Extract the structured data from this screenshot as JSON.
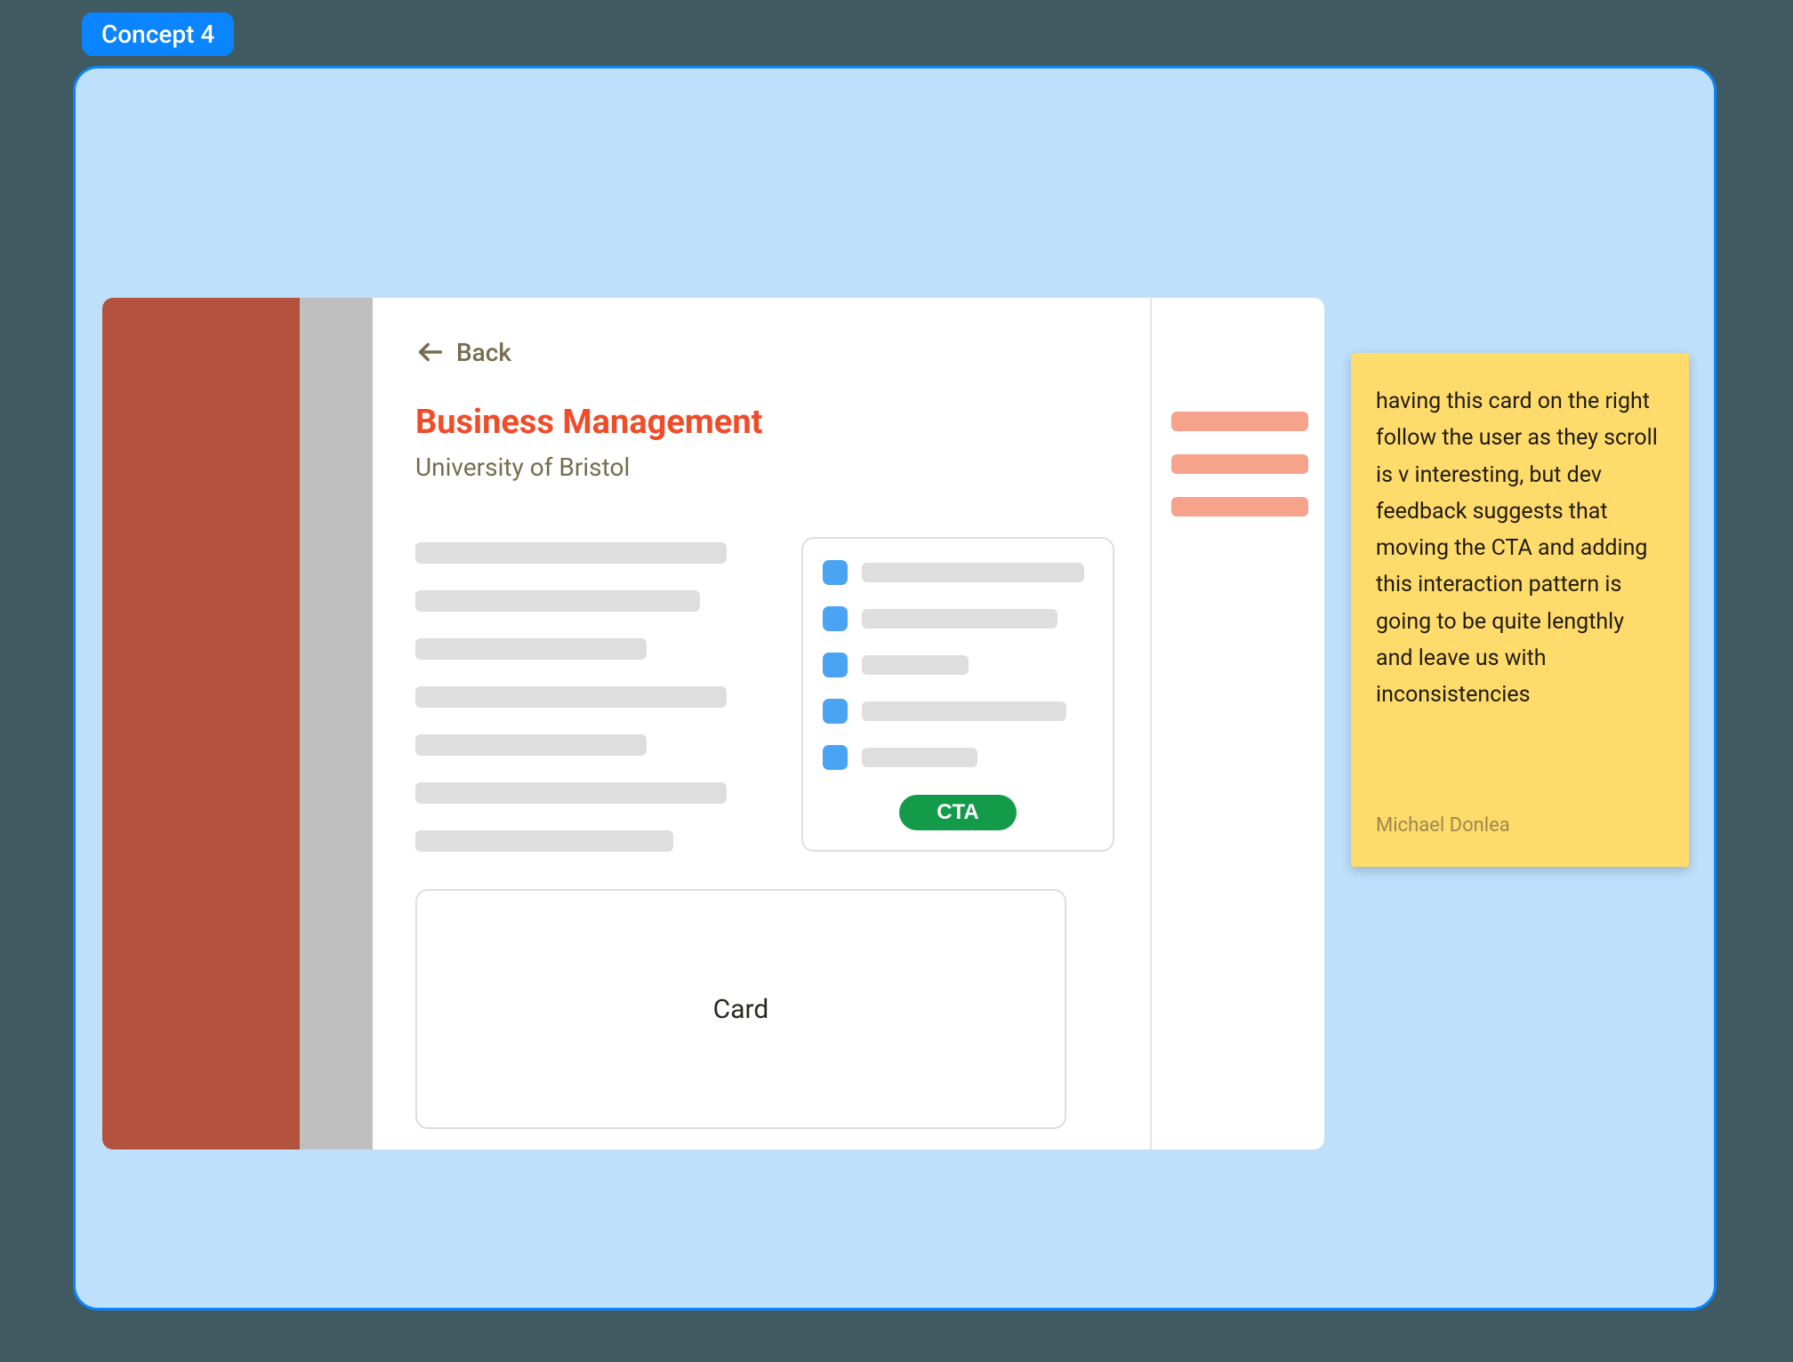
{
  "concept_tag": "Concept 4",
  "mockup": {
    "back_label": "Back",
    "title": "Business Management",
    "subtitle": "University of Bristol",
    "cta_label": "CTA",
    "card_label": "Card"
  },
  "sticky_note": {
    "text": "having this card on the right follow the user as they scroll is v interesting, but dev feedback suggests that moving the CTA and adding this interaction pattern is going to be quite lengthly and leave us with inconsistencies",
    "author": "Michael Donlea"
  },
  "colors": {
    "accent_blue": "#0a84ff",
    "panel_bg": "#bee0fa",
    "page_bg": "#3f5a61",
    "title_red": "#f04c2a",
    "muted_text": "#766d4e",
    "cta_green": "#149b49",
    "note_bg": "#ffdb6b",
    "column_red": "#b3533e",
    "column_gray": "#bfbfbf",
    "placeholder_gray": "#dedede",
    "bullet_blue": "#4aa3f3",
    "rail_coral": "#f7a38b"
  }
}
